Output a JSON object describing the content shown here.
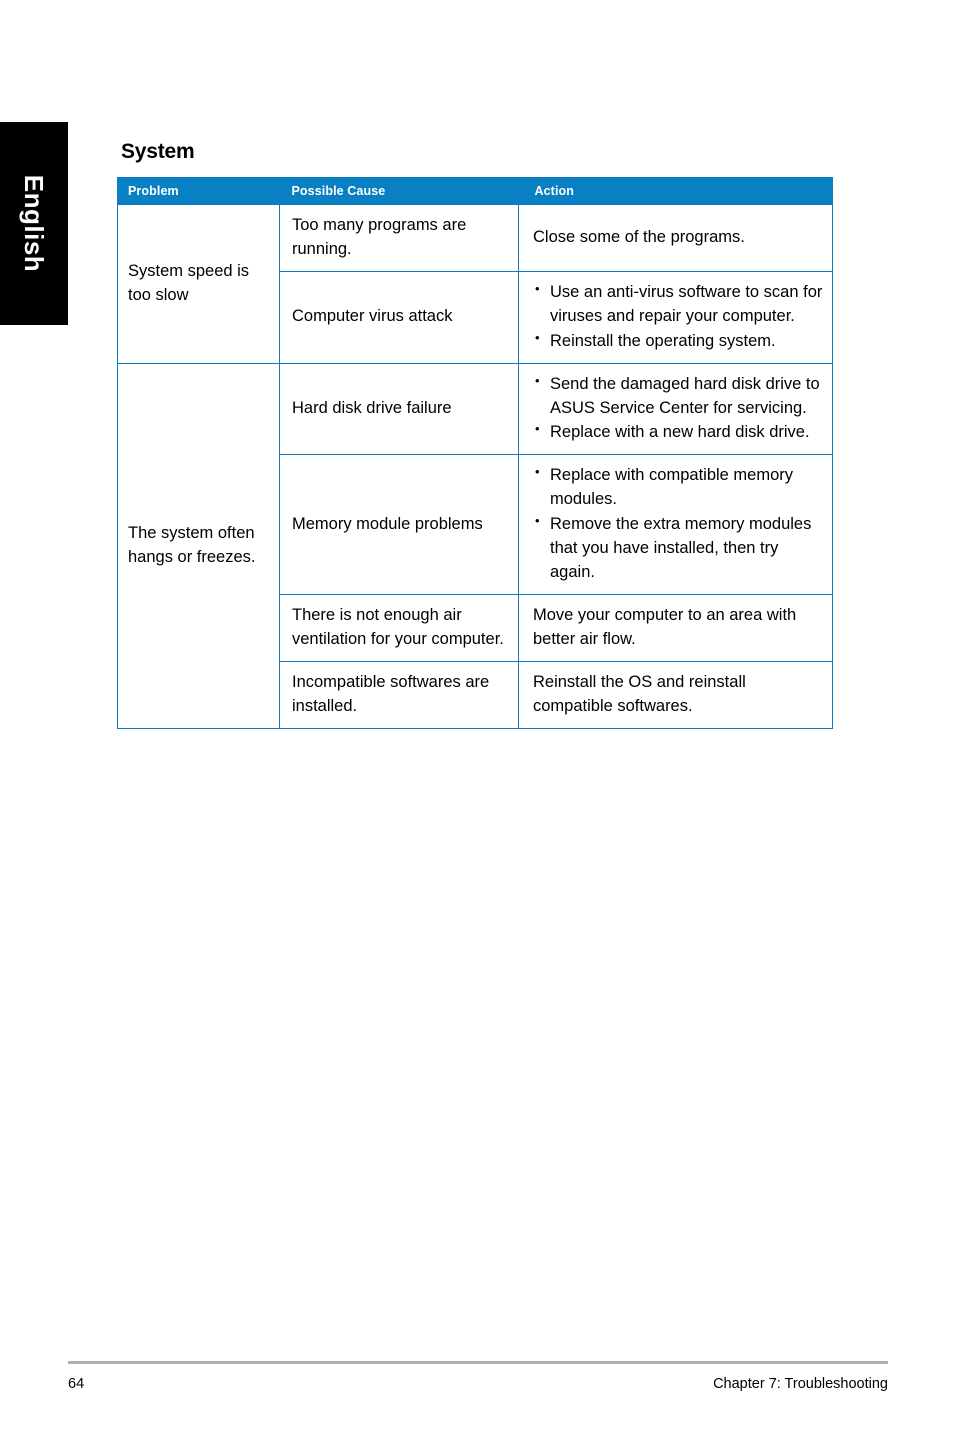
{
  "sidebar": {
    "language_tab": "English"
  },
  "page": {
    "section_title": "System"
  },
  "table": {
    "headers": {
      "problem": "Problem",
      "possible_cause": "Possible Cause",
      "action": "Action"
    },
    "groups": [
      {
        "problem": "System speed is too slow",
        "rows": [
          {
            "cause": "Too many programs are running.",
            "action_text": "Close some of the programs.",
            "action_bullets": []
          },
          {
            "cause": "Computer virus attack",
            "action_text": "",
            "action_bullets": [
              "Use an anti-virus software to scan for viruses and repair your computer.",
              "Reinstall the operating system."
            ]
          }
        ]
      },
      {
        "problem": "The system often hangs or freezes.",
        "rows": [
          {
            "cause": "Hard disk drive failure",
            "action_text": "",
            "action_bullets": [
              "Send the damaged hard disk drive to ASUS Service Center for servicing.",
              "Replace with a new hard disk drive."
            ]
          },
          {
            "cause": "Memory module problems",
            "action_text": "",
            "action_bullets": [
              "Replace with compatible memory modules.",
              "Remove the extra memory modules that you have installed, then try again."
            ]
          },
          {
            "cause": "There is not enough air ventilation for your computer.",
            "action_text": "Move your computer to an area with better air flow.",
            "action_bullets": []
          },
          {
            "cause": "Incompatible softwares are installed.",
            "action_text": "Reinstall the OS and reinstall compatible softwares.",
            "action_bullets": []
          }
        ]
      }
    ]
  },
  "footer": {
    "page_number": "64",
    "chapter": "Chapter 7: Troubleshooting"
  },
  "colors": {
    "header_blue": "#0a80c4",
    "border_blue": "#0d7dc0",
    "tab_black": "#000000",
    "footer_rule": "#b0b0b0"
  }
}
